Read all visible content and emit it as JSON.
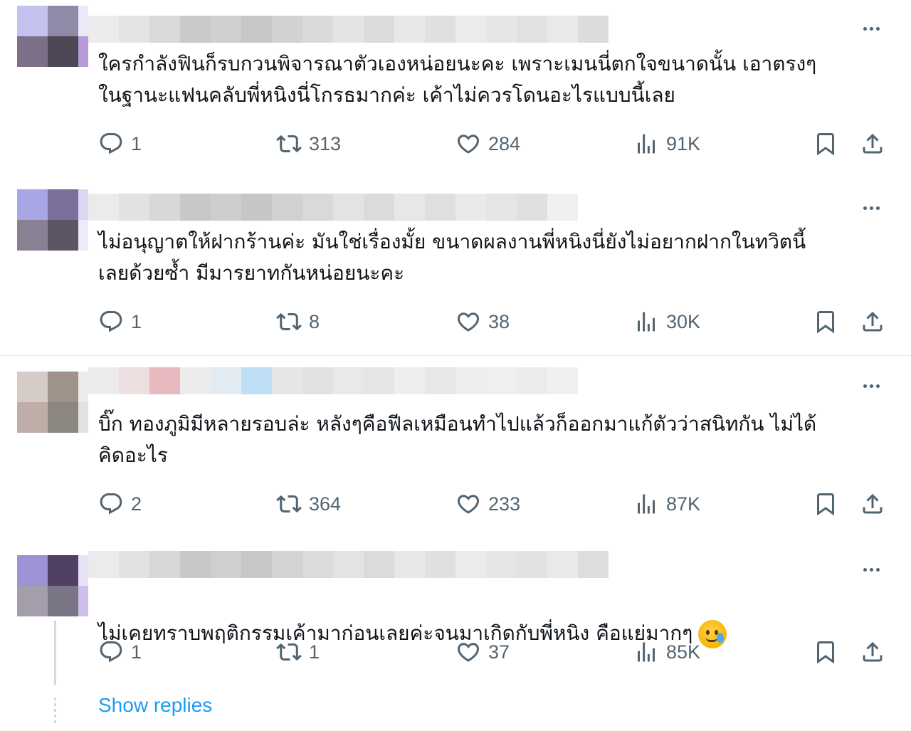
{
  "colors": {
    "text": "#0f1419",
    "muted": "#536471",
    "link": "#1d9bf0",
    "divider": "#e6ecf0"
  },
  "tweets": [
    {
      "text": "ใครกำลังฟินก็รบกวนพิจารณาตัวเองหน่อยนะคะ เพราะเมนนี่ตกใจขนาดนั้น เอาตรงๆ\nในฐานะแฟนคลับพี่หนิงนี่โกรธมากค่ะ เค้าไม่ควรโดนอะไรแบบนี้เลย",
      "replies": "1",
      "retweets": "313",
      "likes": "284",
      "views": "91K"
    },
    {
      "text": "ไม่อนุญาตให้ฝากร้านค่ะ มันใช่เรื่องมั้ย ขนาดผลงานพี่หนิงนี่ยังไม่อยากฝากในทวิตนี้\nเลยด้วยซ้ำ มีมารยาทกันหน่อยนะคะ",
      "replies": "1",
      "retweets": "8",
      "likes": "38",
      "views": "30K"
    },
    {
      "text": "บิ๊ก ทองภูมิมีหลายรอบล่ะ หลังๆคือฟีลเหมือนทำไปแล้วก็ออกมาแก้ตัวว่าสนิทกัน ไม่ได้\nคิดอะไร",
      "replies": "2",
      "retweets": "364",
      "likes": "233",
      "views": "87K"
    },
    {
      "text": "ไม่เคยทราบพฤติกรรมเค้ามาก่อนเลยค่ะจนมาเกิดกับพี่หนิง คือแย่มากๆ",
      "emoji": "face-holding-back-tears",
      "replies": "1",
      "retweets": "1",
      "likes": "37",
      "views": "85K"
    }
  ],
  "show_replies_label": "Show replies",
  "icons": [
    "more-icon",
    "reply-icon",
    "retweet-icon",
    "like-icon",
    "views-icon",
    "bookmark-icon",
    "share-icon"
  ]
}
